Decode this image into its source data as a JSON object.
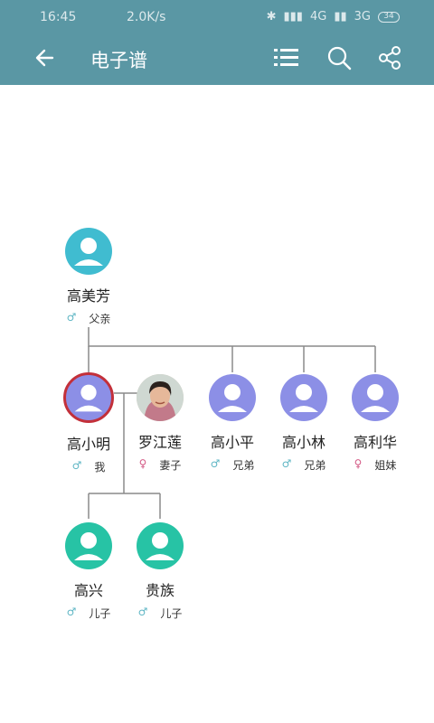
{
  "status_bar": {
    "time": "16:45",
    "speed": "2.0K/s",
    "network_1": "4G",
    "network_2": "3G",
    "battery": "34"
  },
  "toolbar": {
    "title": "电子谱"
  },
  "colors": {
    "appbar": "#5a97a4",
    "teal_avatar": "#27c3a5",
    "blue_avatar": "#40bcd0",
    "purple_avatar": "#8c8fe6",
    "selected_ring": "#c3303a",
    "male_symbol": "#5fb6c4",
    "female_symbol": "#d45b86"
  },
  "members": {
    "father": {
      "name": "高美芳",
      "sex": "♂",
      "relation": "父亲",
      "avatar": "blue-person-icon"
    },
    "self": {
      "name": "高小明",
      "sex": "♂",
      "relation": "我",
      "avatar": "purple-person-icon",
      "selected": true
    },
    "wife": {
      "name": "罗江莲",
      "sex": "♀",
      "relation": "妻子",
      "avatar": "photo"
    },
    "brother1": {
      "name": "高小平",
      "sex": "♂",
      "relation": "兄弟",
      "avatar": "purple-person-icon"
    },
    "brother2": {
      "name": "高小林",
      "sex": "♂",
      "relation": "兄弟",
      "avatar": "purple-person-icon"
    },
    "sister": {
      "name": "高利华",
      "sex": "♀",
      "relation": "姐妹",
      "avatar": "purple-person-icon"
    },
    "son1": {
      "name": "高兴",
      "sex": "♂",
      "relation": "儿子",
      "avatar": "teal-person-icon"
    },
    "son2": {
      "name": "贵族",
      "sex": "♂",
      "relation": "儿子",
      "avatar": "teal-person-icon"
    }
  }
}
